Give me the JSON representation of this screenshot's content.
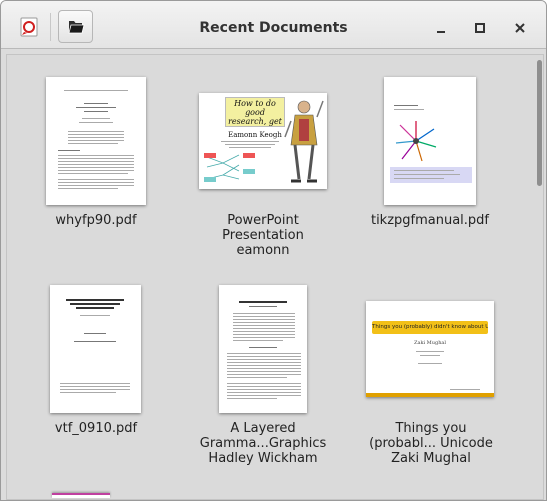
{
  "window": {
    "title": "Recent Documents",
    "icons": {
      "app": "evince-app-icon",
      "open": "open-folder-icon",
      "minimize": "minimize-icon",
      "maximize": "maximize-icon",
      "close": "close-icon"
    }
  },
  "documents": [
    {
      "label": "whyfp90.pdf"
    },
    {
      "label": "PowerPoint\nPresentation\neamonn",
      "thumb_title": "How to do good research, get it published",
      "thumb_author": "Eamonn Keogh"
    },
    {
      "label": "tikzpgfmanual.pdf"
    },
    {
      "label": "vtf_0910.pdf"
    },
    {
      "label": "A Layered\nGramma...Graphics\nHadley Wickham"
    },
    {
      "label": "Things you\n(probabl... Unicode\nZaki Mughal",
      "thumb_title": "Things you (probably) didn't know about Unicode",
      "thumb_author": "Zaki Mughal"
    }
  ],
  "colors": {
    "background": "#dadada",
    "slide_yellow": "#f2c018",
    "slide_bar": "#e0a000",
    "peek_magenta": "#c040a0"
  }
}
